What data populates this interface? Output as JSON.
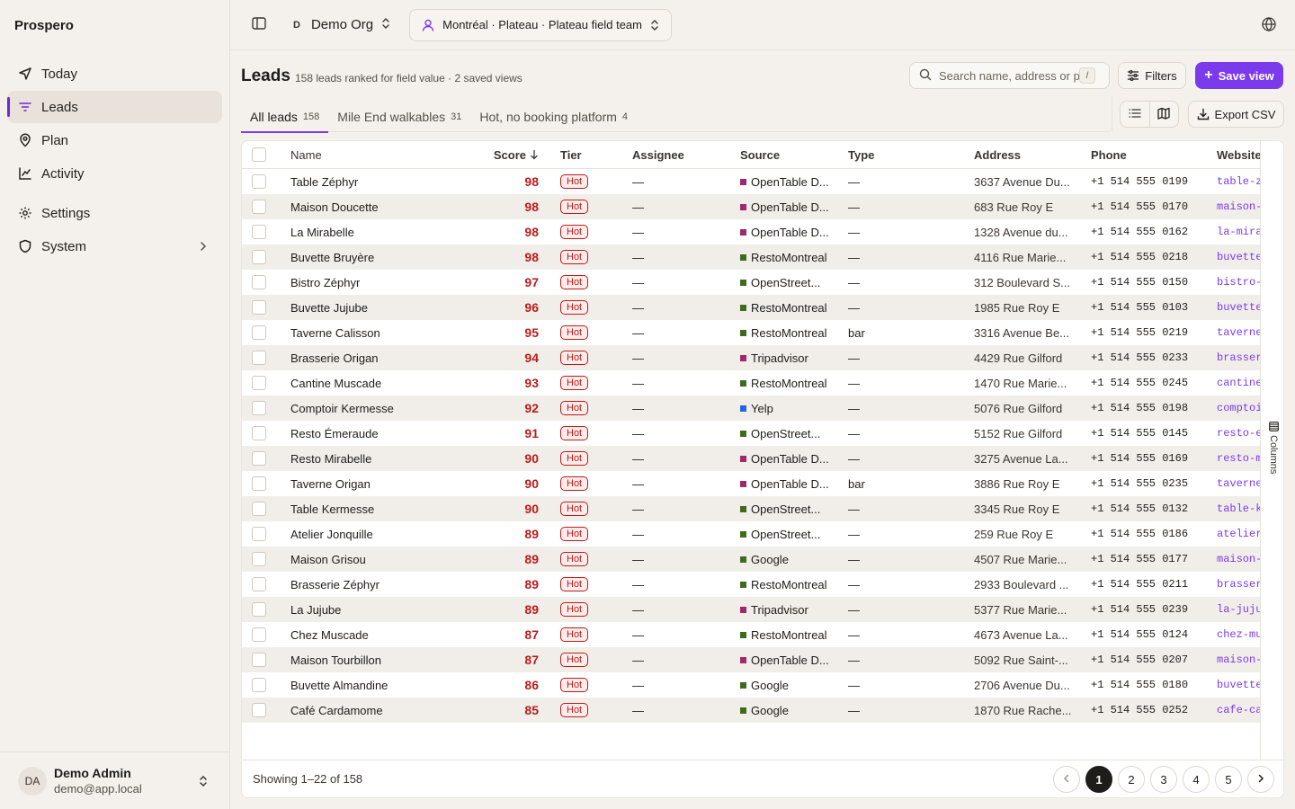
{
  "app": {
    "name": "Prospero"
  },
  "sidebar": {
    "items": [
      {
        "label": "Today",
        "icon": "send-icon"
      },
      {
        "label": "Leads",
        "icon": "filter-lines-icon",
        "active": true
      },
      {
        "label": "Plan",
        "icon": "map-pin-icon"
      },
      {
        "label": "Activity",
        "icon": "activity-icon"
      },
      {
        "label": "Settings",
        "icon": "gear-icon"
      },
      {
        "label": "System",
        "icon": "shield-icon"
      }
    ],
    "user": {
      "initials": "DA",
      "name": "Demo Admin",
      "email": "demo@app.local"
    }
  },
  "topbar": {
    "org_letter": "D",
    "org_name": "Demo Org",
    "team": "Montréal · Plateau · Plateau field team"
  },
  "header": {
    "title": "Leads",
    "subtitle": "158 leads ranked for field value · 2 saved views",
    "search_placeholder": "Search name, address or pl",
    "search_shortcut": "/",
    "filters_label": "Filters",
    "save_view_label": "Save view",
    "export_label": "Export CSV"
  },
  "tabs": [
    {
      "label": "All leads",
      "count": "158",
      "active": true
    },
    {
      "label": "Mile End walkables",
      "count": "31"
    },
    {
      "label": "Hot, no booking platform",
      "count": "4"
    }
  ],
  "colors": {
    "accent": "#7c3aed",
    "hot": "#b91c1c",
    "source_opentable": "#9d2a6b",
    "source_green": "#3f6b1f",
    "source_yelp": "#2563eb"
  },
  "table": {
    "columns": {
      "name": "Name",
      "score": "Score",
      "tier": "Tier",
      "assignee": "Assignee",
      "source": "Source",
      "type": "Type",
      "address": "Address",
      "phone": "Phone",
      "website": "Website"
    },
    "rows": [
      {
        "name": "Table Zéphyr",
        "score": "98",
        "tier": "Hot",
        "assignee": "—",
        "source": "OpenTable D...",
        "src_color": "#9d2a6b",
        "type": "—",
        "address": "3637 Avenue Du...",
        "phone": "+1 514 555 0199",
        "website": "table-ze"
      },
      {
        "name": "Maison Doucette",
        "score": "98",
        "tier": "Hot",
        "assignee": "—",
        "source": "OpenTable D...",
        "src_color": "#9d2a6b",
        "type": "—",
        "address": "683 Rue Roy E",
        "phone": "+1 514 555 0170",
        "website": "maison-"
      },
      {
        "name": "La Mirabelle",
        "score": "98",
        "tier": "Hot",
        "assignee": "—",
        "source": "OpenTable D...",
        "src_color": "#9d2a6b",
        "type": "—",
        "address": "1328 Avenue du...",
        "phone": "+1 514 555 0162",
        "website": "la-mirab"
      },
      {
        "name": "Buvette Bruyère",
        "score": "98",
        "tier": "Hot",
        "assignee": "—",
        "source": "RestoMontreal",
        "src_color": "#3f6b1f",
        "type": "—",
        "address": "4116 Rue Marie...",
        "phone": "+1 514 555 0218",
        "website": "buvette-"
      },
      {
        "name": "Bistro Zéphyr",
        "score": "97",
        "tier": "Hot",
        "assignee": "—",
        "source": "OpenStreet...",
        "src_color": "#3f6b1f",
        "type": "—",
        "address": "312 Boulevard S...",
        "phone": "+1 514 555 0150",
        "website": "bistro-z"
      },
      {
        "name": "Buvette Jujube",
        "score": "96",
        "tier": "Hot",
        "assignee": "—",
        "source": "RestoMontreal",
        "src_color": "#3f6b1f",
        "type": "—",
        "address": "1985 Rue Roy E",
        "phone": "+1 514 555 0103",
        "website": "buvette-"
      },
      {
        "name": "Taverne Calisson",
        "score": "95",
        "tier": "Hot",
        "assignee": "—",
        "source": "RestoMontreal",
        "src_color": "#3f6b1f",
        "type": "bar",
        "address": "3316 Avenue Be...",
        "phone": "+1 514 555 0219",
        "website": "taverne-"
      },
      {
        "name": "Brasserie Origan",
        "score": "94",
        "tier": "Hot",
        "assignee": "—",
        "source": "Tripadvisor",
        "src_color": "#9d2a6b",
        "type": "—",
        "address": "4429 Rue Gilford",
        "phone": "+1 514 555 0233",
        "website": "brasseri"
      },
      {
        "name": "Cantine Muscade",
        "score": "93",
        "tier": "Hot",
        "assignee": "—",
        "source": "RestoMontreal",
        "src_color": "#3f6b1f",
        "type": "—",
        "address": "1470 Rue Marie...",
        "phone": "+1 514 555 0245",
        "website": "cantine-"
      },
      {
        "name": "Comptoir Kermesse",
        "score": "92",
        "tier": "Hot",
        "assignee": "—",
        "source": "Yelp",
        "src_color": "#2563eb",
        "type": "—",
        "address": "5076 Rue Gilford",
        "phone": "+1 514 555 0198",
        "website": "comptoi"
      },
      {
        "name": "Resto Émeraude",
        "score": "91",
        "tier": "Hot",
        "assignee": "—",
        "source": "OpenStreet...",
        "src_color": "#3f6b1f",
        "type": "—",
        "address": "5152 Rue Gilford",
        "phone": "+1 514 555 0145",
        "website": "resto-e-"
      },
      {
        "name": "Resto Mirabelle",
        "score": "90",
        "tier": "Hot",
        "assignee": "—",
        "source": "OpenTable D...",
        "src_color": "#9d2a6b",
        "type": "—",
        "address": "3275 Avenue La...",
        "phone": "+1 514 555 0169",
        "website": "resto-m"
      },
      {
        "name": "Taverne Origan",
        "score": "90",
        "tier": "Hot",
        "assignee": "—",
        "source": "OpenTable D...",
        "src_color": "#9d2a6b",
        "type": "bar",
        "address": "3886 Rue Roy E",
        "phone": "+1 514 555 0235",
        "website": "taverne-"
      },
      {
        "name": "Table Kermesse",
        "score": "90",
        "tier": "Hot",
        "assignee": "—",
        "source": "OpenStreet...",
        "src_color": "#3f6b1f",
        "type": "—",
        "address": "3345 Rue Roy E",
        "phone": "+1 514 555 0132",
        "website": "table-ke"
      },
      {
        "name": "Atelier Jonquille",
        "score": "89",
        "tier": "Hot",
        "assignee": "—",
        "source": "OpenStreet...",
        "src_color": "#3f6b1f",
        "type": "—",
        "address": "259 Rue Roy E",
        "phone": "+1 514 555 0186",
        "website": "atelier-j"
      },
      {
        "name": "Maison Grisou",
        "score": "89",
        "tier": "Hot",
        "assignee": "—",
        "source": "Google",
        "src_color": "#3f6b1f",
        "type": "—",
        "address": "4507 Rue Marie...",
        "phone": "+1 514 555 0177",
        "website": "maison-"
      },
      {
        "name": "Brasserie Zéphyr",
        "score": "89",
        "tier": "Hot",
        "assignee": "—",
        "source": "RestoMontreal",
        "src_color": "#3f6b1f",
        "type": "—",
        "address": "2933 Boulevard ...",
        "phone": "+1 514 555 0211",
        "website": "brasseri"
      },
      {
        "name": "La Jujube",
        "score": "89",
        "tier": "Hot",
        "assignee": "—",
        "source": "Tripadvisor",
        "src_color": "#9d2a6b",
        "type": "—",
        "address": "5377 Rue Marie...",
        "phone": "+1 514 555 0239",
        "website": "la-jujube"
      },
      {
        "name": "Chez Muscade",
        "score": "87",
        "tier": "Hot",
        "assignee": "—",
        "source": "RestoMontreal",
        "src_color": "#3f6b1f",
        "type": "—",
        "address": "4673 Avenue La...",
        "phone": "+1 514 555 0124",
        "website": "chez-mu"
      },
      {
        "name": "Maison Tourbillon",
        "score": "87",
        "tier": "Hot",
        "assignee": "—",
        "source": "OpenTable D...",
        "src_color": "#9d2a6b",
        "type": "—",
        "address": "5092 Rue Saint-...",
        "phone": "+1 514 555 0207",
        "website": "maison-"
      },
      {
        "name": "Buvette Almandine",
        "score": "86",
        "tier": "Hot",
        "assignee": "—",
        "source": "Google",
        "src_color": "#3f6b1f",
        "type": "—",
        "address": "2706 Avenue Du...",
        "phone": "+1 514 555 0180",
        "website": "buvette-"
      },
      {
        "name": "Café Cardamome",
        "score": "85",
        "tier": "Hot",
        "assignee": "—",
        "source": "Google",
        "src_color": "#3f6b1f",
        "type": "—",
        "address": "1870 Rue Rache...",
        "phone": "+1 514 555 0252",
        "website": "cafe-ca"
      }
    ],
    "columns_label": "Columns"
  },
  "footer": {
    "showing": "Showing 1–22 of 158",
    "pages": [
      "1",
      "2",
      "3",
      "4",
      "5"
    ],
    "current_page": "1"
  }
}
